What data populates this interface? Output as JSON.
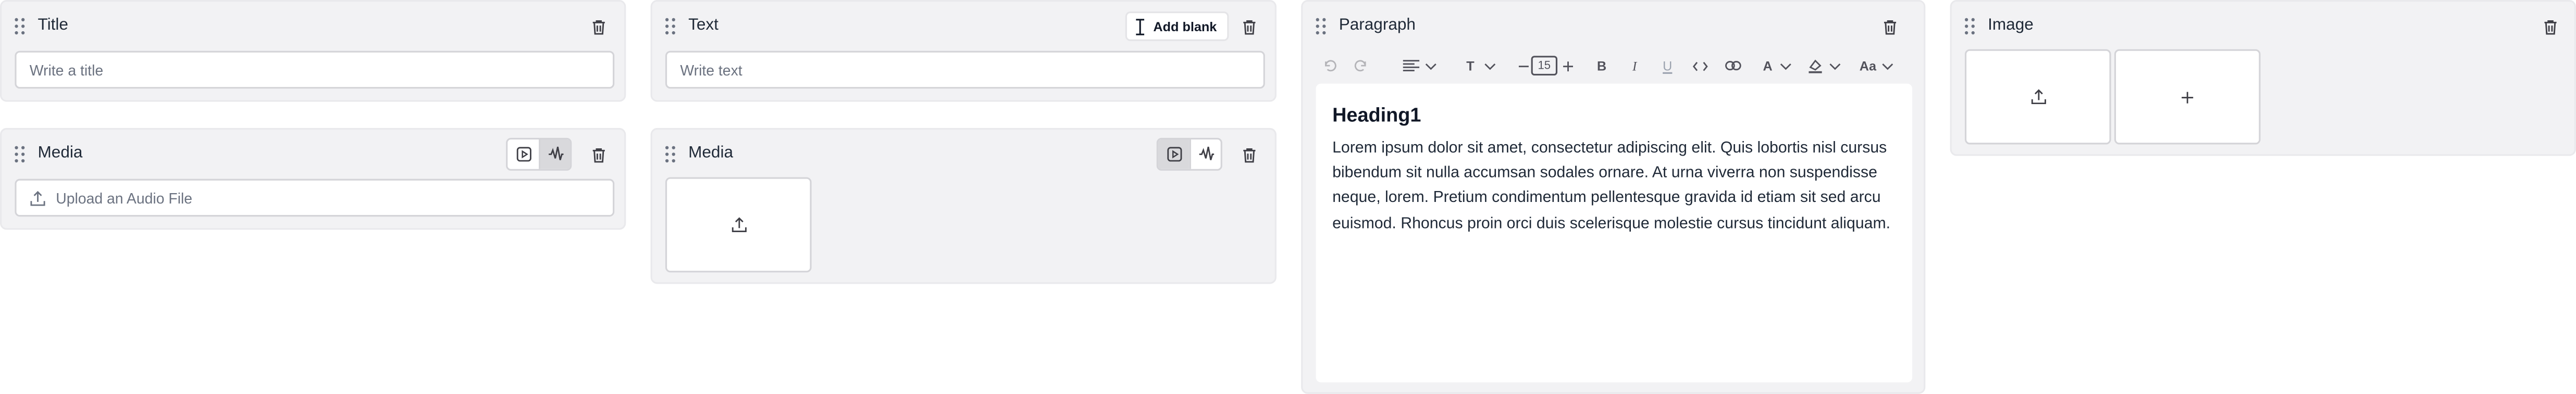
{
  "cards": {
    "title_card": {
      "label": "Title",
      "input_placeholder": "Write a title"
    },
    "text_card": {
      "label": "Text",
      "input_placeholder": "Write text",
      "add_blank_label": "Add blank"
    },
    "media_card_1": {
      "label": "Media",
      "upload_label": "Upload an Audio File",
      "selected_type": "audio"
    },
    "media_card_2": {
      "label": "Media",
      "selected_type": "video"
    },
    "paragraph_card": {
      "label": "Paragraph",
      "font_size": "15",
      "text_color_glyph": "A",
      "case_glyph": "Aa",
      "bold_glyph": "B",
      "italic_glyph": "I",
      "underline_glyph": "U",
      "font_glyph": "T",
      "heading": "Heading1",
      "body": "Lorem ipsum dolor sit amet, consectetur adipiscing elit. Quis lobortis nisl cursus bibendum sit nulla accumsan sodales ornare. At urna viverra non suspendisse neque, lorem. Pretium condimentum pellentesque gravida id etiam sit sed arcu euismod. Rhoncus proin orci duis scelerisque molestie cursus tincidunt aliquam."
    },
    "image_card": {
      "label": "Image"
    }
  },
  "colors": {
    "card_bg": "#f2f2f4",
    "border": "#d4d4d8",
    "text": "#1f2937",
    "muted": "#6b7280",
    "active_toggle": "#d9d9dc"
  }
}
